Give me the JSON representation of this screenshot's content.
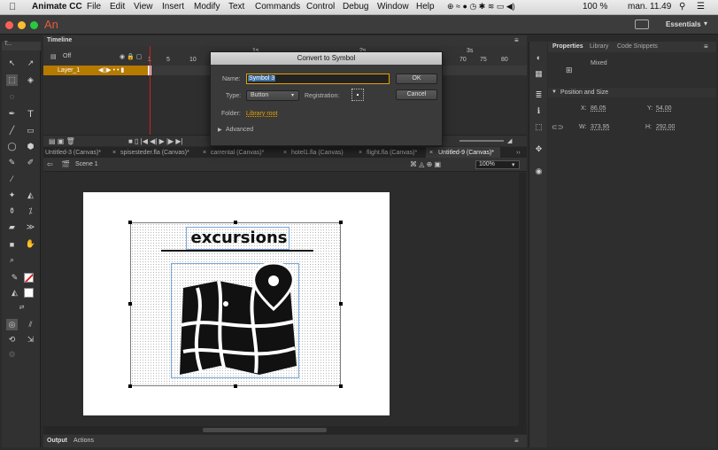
{
  "menubar": {
    "app": "Animate CC",
    "items": [
      "File",
      "Edit",
      "View",
      "Insert",
      "Modify",
      "Text",
      "Commands",
      "Control",
      "Debug",
      "Window",
      "Help"
    ],
    "battery": "100 %",
    "clock": "man. 11.49"
  },
  "appbar": {
    "logo": "An",
    "workspace": "Essentials"
  },
  "timeline": {
    "tab": "Timeline",
    "layer_label": "Off",
    "layer_name": "Layer_1",
    "ruler": [
      "1",
      "5",
      "10",
      "70",
      "75",
      "80"
    ],
    "sec_marks": [
      "1s",
      "2s",
      "3s"
    ]
  },
  "dialog": {
    "title": "Convert to Symbol",
    "name_label": "Name:",
    "name_value": "Symbol 3",
    "type_label": "Type:",
    "type_value": "Button",
    "registration_label": "Registration:",
    "folder_label": "Folder:",
    "folder_value": "Library root",
    "advanced": "Advanced",
    "ok": "OK",
    "cancel": "Cancel"
  },
  "doc_tabs": [
    "Untitled-3 (Canvas)*",
    "spisesteder.fla (Canvas)*",
    "carrental (Canvas)*",
    "hotel1.fla (Canvas)",
    "flight.fla (Canvas)*",
    "Untitled-9 (Canvas)*"
  ],
  "scene": {
    "label": "Scene 1",
    "zoom": "100%"
  },
  "artwork": {
    "heading": "excursions"
  },
  "properties": {
    "tabs": [
      "Properties",
      "Library",
      "Code Snippets"
    ],
    "mixed": "Mixed",
    "section": "Position and Size",
    "x_label": "X:",
    "x_value": "86.05",
    "y_label": "Y:",
    "y_value": "54.00",
    "w_label": "W:",
    "w_value": "373.95",
    "h_label": "H:",
    "h_value": "292.00"
  },
  "bottom_tabs": [
    "Output",
    "Actions"
  ]
}
